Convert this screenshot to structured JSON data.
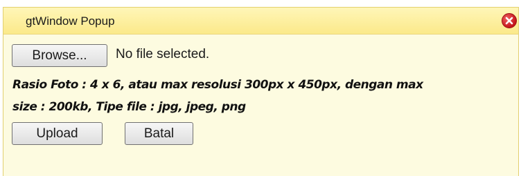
{
  "window": {
    "title": "gtWindow Popup",
    "close_icon": "close-icon",
    "title_bar_color": "#fbe98a",
    "background_color": "#fdfbe0",
    "close_color": "#d8262c"
  },
  "file_input": {
    "browse_label": "Browse...",
    "status": "No file selected."
  },
  "info_lines": [
    "Rasio Foto : 4 x 6, atau max resolusi 300px x 450px, dengan max",
    "size : 200kb, Tipe file : jpg, jpeg, png"
  ],
  "buttons": {
    "upload_label": "Upload",
    "cancel_label": "Batal"
  }
}
